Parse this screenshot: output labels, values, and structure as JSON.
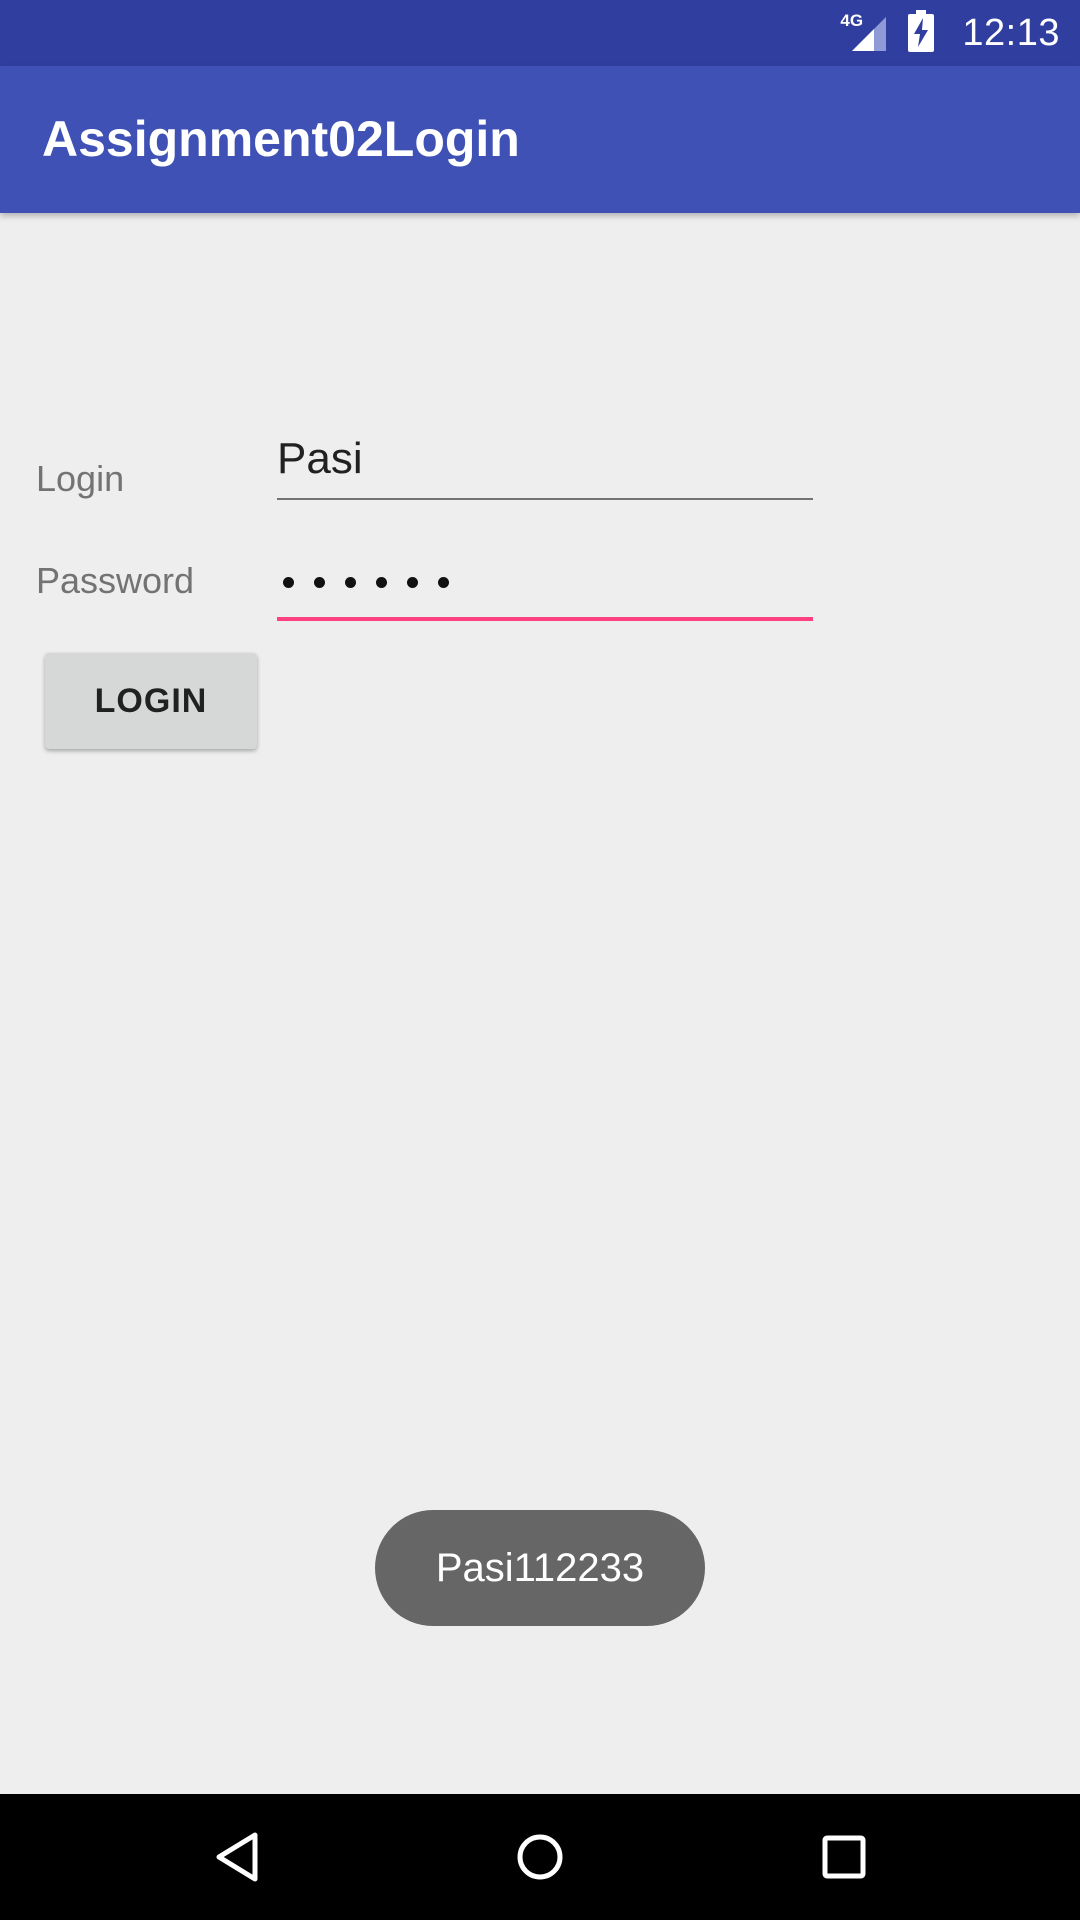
{
  "status_bar": {
    "network": "4G",
    "time": "12:13",
    "icons": [
      "signal-icon",
      "battery-charging-icon"
    ]
  },
  "app_bar": {
    "title": "Assignment02Login"
  },
  "form": {
    "login_label": "Login",
    "login_value": "Pasi",
    "password_label": "Password",
    "password_dot_count": 6,
    "accent_color": "#ff4081"
  },
  "login_button": {
    "label": "LOGIN"
  },
  "toast": {
    "message": "Pasi112233"
  },
  "nav_bar": {
    "icons": [
      "back-icon",
      "home-icon",
      "recents-icon"
    ]
  },
  "colors": {
    "primary": "#3f51b5",
    "primary_dark": "#303f9f",
    "background": "#eeeeee"
  }
}
